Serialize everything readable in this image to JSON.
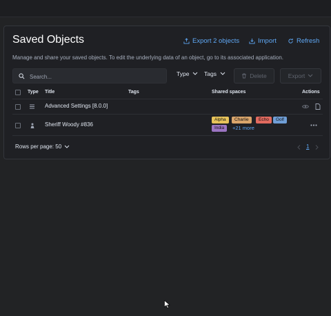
{
  "page": {
    "title": "Saved Objects",
    "description": "Manage and share your saved objects. To edit the underlying data of an object, go to its associated application.",
    "actions": {
      "export_label": "Export 2 objects",
      "import_label": "Import",
      "refresh_label": "Refresh"
    }
  },
  "toolbar": {
    "search_placeholder": "Search...",
    "type_filter_label": "Type",
    "tags_filter_label": "Tags",
    "delete_label": "Delete",
    "export_label": "Export"
  },
  "table": {
    "columns": {
      "type": "Type",
      "title": "Title",
      "tags": "Tags",
      "shared_spaces": "Shared spaces",
      "actions": "Actions"
    },
    "rows": [
      {
        "type_icon": "settings-list-icon",
        "title": "Advanced Settings [8.0.0]",
        "spaces": [],
        "more_spaces": ""
      },
      {
        "type_icon": "user-icon",
        "title": "Sheriff Woody #836",
        "spaces": [
          {
            "name": "Alpha",
            "color": "#e7c35a"
          },
          {
            "name": "Charlie",
            "color": "#d9a56b"
          },
          {
            "name": "Echo",
            "color": "#e16a5f"
          },
          {
            "name": "Golf",
            "color": "#6f9ed6"
          },
          {
            "name": "India",
            "color": "#9b74c2"
          }
        ],
        "more_spaces": "+21 more"
      }
    ]
  },
  "footer": {
    "rows_per_page_label": "Rows per page: 50",
    "current_page": "1"
  },
  "colors": {
    "accent": "#5fa8f5",
    "background": "#222325",
    "panel": "#1f2024"
  }
}
